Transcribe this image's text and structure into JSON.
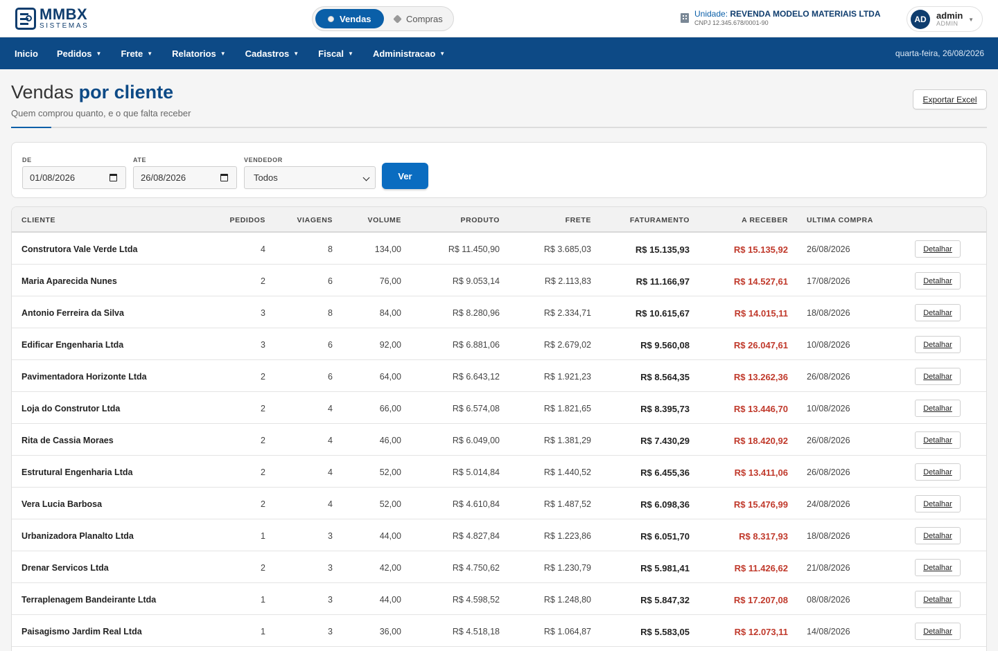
{
  "brand": {
    "name": "MMBX",
    "sub": "SISTEMAS"
  },
  "mode_toggle": {
    "vendas": "Vendas",
    "compras": "Compras"
  },
  "unit": {
    "label": "Unidade:",
    "name": "REVENDA MODELO MATERIAIS LTDA",
    "cnpj": "CNPJ 12.345.678/0001-90"
  },
  "user": {
    "initials": "AD",
    "name": "admin",
    "role": "ADMIN"
  },
  "nav": {
    "items": [
      "Inicio",
      "Pedidos",
      "Frete",
      "Relatorios",
      "Cadastros",
      "Fiscal",
      "Administracao"
    ],
    "date": "quarta-feira, 26/08/2026"
  },
  "page": {
    "title_light": "Vendas",
    "title_bold": "por cliente",
    "subtitle": "Quem comprou quanto, e o que falta receber",
    "export_label": "Exportar Excel"
  },
  "filters": {
    "de_label": "DE",
    "de_value": "01/08/2026",
    "ate_label": "ATE",
    "ate_value": "26/08/2026",
    "vendedor_label": "VENDEDOR",
    "vendedor_value": "Todos",
    "submit_label": "Ver"
  },
  "table": {
    "headers": [
      "CLIENTE",
      "PEDIDOS",
      "VIAGENS",
      "VOLUME",
      "PRODUTO",
      "FRETE",
      "FATURAMENTO",
      "A RECEBER",
      "ULTIMA COMPRA"
    ],
    "action_label": "Detalhar",
    "rows": [
      [
        "Construtora Vale Verde Ltda",
        "4",
        "8",
        "134,00",
        "R$ 11.450,90",
        "R$ 3.685,03",
        "R$ 15.135,93",
        "R$ 15.135,92",
        "26/08/2026"
      ],
      [
        "Maria Aparecida Nunes",
        "2",
        "6",
        "76,00",
        "R$ 9.053,14",
        "R$ 2.113,83",
        "R$ 11.166,97",
        "R$ 14.527,61",
        "17/08/2026"
      ],
      [
        "Antonio Ferreira da Silva",
        "3",
        "8",
        "84,00",
        "R$ 8.280,96",
        "R$ 2.334,71",
        "R$ 10.615,67",
        "R$ 14.015,11",
        "18/08/2026"
      ],
      [
        "Edificar Engenharia Ltda",
        "3",
        "6",
        "92,00",
        "R$ 6.881,06",
        "R$ 2.679,02",
        "R$ 9.560,08",
        "R$ 26.047,61",
        "10/08/2026"
      ],
      [
        "Pavimentadora Horizonte Ltda",
        "2",
        "6",
        "64,00",
        "R$ 6.643,12",
        "R$ 1.921,23",
        "R$ 8.564,35",
        "R$ 13.262,36",
        "26/08/2026"
      ],
      [
        "Loja do Construtor Ltda",
        "2",
        "4",
        "66,00",
        "R$ 6.574,08",
        "R$ 1.821,65",
        "R$ 8.395,73",
        "R$ 13.446,70",
        "10/08/2026"
      ],
      [
        "Rita de Cassia Moraes",
        "2",
        "4",
        "46,00",
        "R$ 6.049,00",
        "R$ 1.381,29",
        "R$ 7.430,29",
        "R$ 18.420,92",
        "26/08/2026"
      ],
      [
        "Estrutural Engenharia Ltda",
        "2",
        "4",
        "52,00",
        "R$ 5.014,84",
        "R$ 1.440,52",
        "R$ 6.455,36",
        "R$ 13.411,06",
        "26/08/2026"
      ],
      [
        "Vera Lucia Barbosa",
        "2",
        "4",
        "52,00",
        "R$ 4.610,84",
        "R$ 1.487,52",
        "R$ 6.098,36",
        "R$ 15.476,99",
        "24/08/2026"
      ],
      [
        "Urbanizadora Planalto Ltda",
        "1",
        "3",
        "44,00",
        "R$ 4.827,84",
        "R$ 1.223,86",
        "R$ 6.051,70",
        "R$ 8.317,93",
        "18/08/2026"
      ],
      [
        "Drenar Servicos Ltda",
        "2",
        "3",
        "42,00",
        "R$ 4.750,62",
        "R$ 1.230,79",
        "R$ 5.981,41",
        "R$ 11.426,62",
        "21/08/2026"
      ],
      [
        "Terraplenagem Bandeirante Ltda",
        "1",
        "3",
        "44,00",
        "R$ 4.598,52",
        "R$ 1.248,80",
        "R$ 5.847,32",
        "R$ 17.207,08",
        "08/08/2026"
      ],
      [
        "Paisagismo Jardim Real Ltda",
        "1",
        "3",
        "36,00",
        "R$ 4.518,18",
        "R$ 1.064,87",
        "R$ 5.583,05",
        "R$ 12.073,11",
        "14/08/2026"
      ]
    ]
  }
}
